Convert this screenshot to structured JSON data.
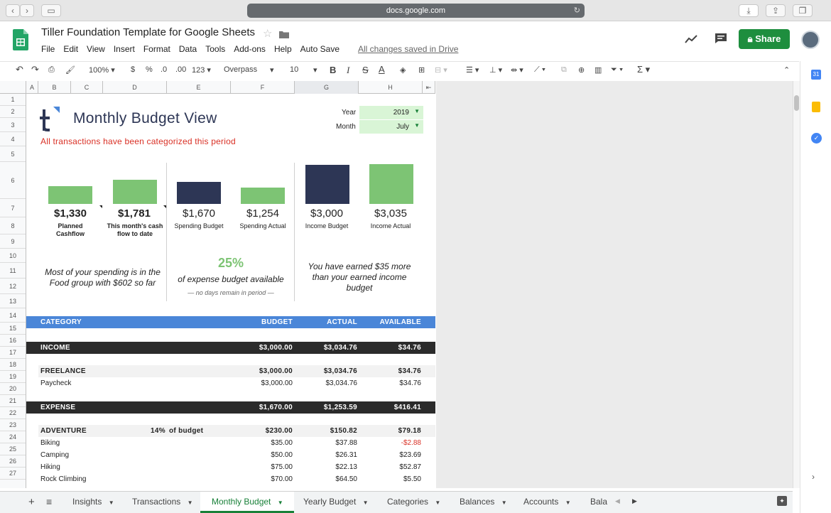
{
  "browser": {
    "url": "docs.google.com"
  },
  "doc": {
    "title": "Tiller Foundation Template for Google Sheets",
    "menus": [
      "File",
      "Edit",
      "View",
      "Insert",
      "Format",
      "Data",
      "Tools",
      "Add-ons",
      "Help",
      "Auto Save"
    ],
    "saved_status": "All changes saved in Drive",
    "share_label": "Share"
  },
  "toolbar": {
    "zoom": "100%",
    "currency": "$",
    "percent": "%",
    "dec_less": ".0",
    "dec_more": ".00",
    "format_more": "123",
    "font": "Overpass",
    "size": "10"
  },
  "columns": [
    "A",
    "B",
    "C",
    "D",
    "E",
    "F",
    "G",
    "H"
  ],
  "rows": [
    "1",
    "2",
    "3",
    "4",
    "5",
    "6",
    "7",
    "8",
    "9",
    "10",
    "11",
    "12",
    "13",
    "14",
    "15",
    "16",
    "17",
    "18",
    "19",
    "20",
    "21",
    "22",
    "23",
    "24",
    "25",
    "26",
    "27"
  ],
  "header": {
    "title": "Monthly Budget View",
    "subtitle": "All transactions have been categorized this period",
    "year_label": "Year",
    "year_value": "2019",
    "month_label": "Month",
    "month_value": "July"
  },
  "summary": {
    "planned_cashflow": {
      "value": "$1,330",
      "label": "Planned Cashflow"
    },
    "cash_flow_to_date": {
      "value": "$1,781",
      "label": "This month's cash flow to date"
    },
    "spending_budget": {
      "value": "$1,670",
      "label": "Spending Budget"
    },
    "spending_actual": {
      "value": "$1,254",
      "label": "Spending Actual"
    },
    "income_budget": {
      "value": "$3,000",
      "label": "Income Budget"
    },
    "income_actual": {
      "value": "$3,035",
      "label": "Income Actual"
    },
    "spending_note": "Most of your spending is in the Food group with $602 so far",
    "expense_pct": "25%",
    "expense_pct_label": "of expense budget available",
    "days_note": "— no days remain in period —",
    "income_note": "You have earned $35 more than your earned income budget"
  },
  "bars": {
    "planned_cashflow": 1330,
    "cash_flow_to_date": 1781,
    "spending_budget": 1670,
    "spending_actual": 1254,
    "income_budget": 3000,
    "income_actual": 3035
  },
  "table": {
    "headers": {
      "category": "CATEGORY",
      "budget": "BUDGET",
      "actual": "ACTUAL",
      "available": "AVAILABLE"
    },
    "income": {
      "label": "INCOME",
      "budget": "$3,000.00",
      "actual": "$3,034.76",
      "available": "$34.76"
    },
    "freelance": {
      "label": "FREELANCE",
      "budget": "$3,000.00",
      "actual": "$3,034.76",
      "available": "$34.76"
    },
    "paycheck": {
      "label": "Paycheck",
      "budget": "$3,000.00",
      "actual": "$3,034.76",
      "available": "$34.76"
    },
    "expense": {
      "label": "EXPENSE",
      "budget": "$1,670.00",
      "actual": "$1,253.59",
      "available": "$416.41"
    },
    "adventure": {
      "label": "ADVENTURE",
      "pct": "14%",
      "pct_label": "of budget",
      "budget": "$230.00",
      "actual": "$150.82",
      "available": "$79.18"
    },
    "biking": {
      "label": "Biking",
      "budget": "$35.00",
      "actual": "$37.88",
      "available": "-$2.88"
    },
    "camping": {
      "label": "Camping",
      "budget": "$50.00",
      "actual": "$26.31",
      "available": "$23.69"
    },
    "hiking": {
      "label": "Hiking",
      "budget": "$75.00",
      "actual": "$22.13",
      "available": "$52.87"
    },
    "climbing": {
      "label": "Rock Climbing",
      "budget": "$70.00",
      "actual": "$64.50",
      "available": "$5.50"
    }
  },
  "tabs": [
    "Insights",
    "Transactions",
    "Monthly Budget",
    "Yearly Budget",
    "Categories",
    "Balances",
    "Accounts",
    "Bala"
  ],
  "colors": {
    "green": "#7dc474",
    "navy": "#2d3655",
    "blue_band": "#4a86d8",
    "dark_band": "#2b2b2b",
    "red": "#d93025",
    "share_green": "#1e8e3e"
  }
}
